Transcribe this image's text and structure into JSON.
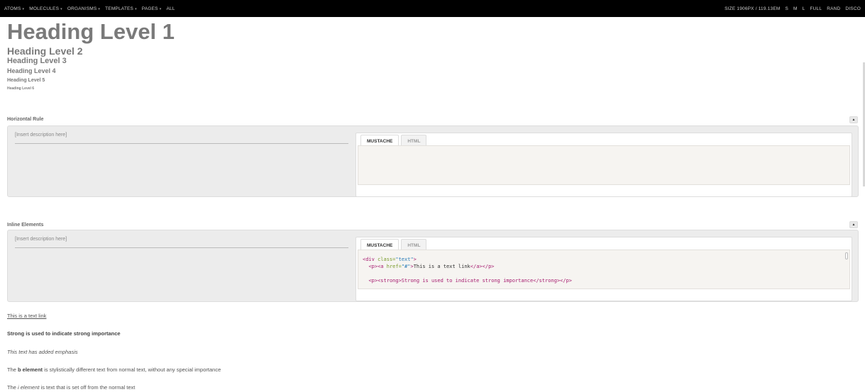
{
  "topnav": {
    "left_items": [
      {
        "label": "ATOMS",
        "caret": "▾"
      },
      {
        "label": "MOLECULES",
        "caret": "▾"
      },
      {
        "label": "ORGANISMS",
        "caret": "▾"
      },
      {
        "label": "TEMPLATES",
        "caret": "▾"
      },
      {
        "label": "PAGES",
        "caret": "▾"
      },
      {
        "label": "ALL",
        "caret": ""
      }
    ],
    "size_label": "SIZE 1906PX / 119.13EM",
    "right_items": [
      "S",
      "M",
      "L",
      "FULL",
      "RAND",
      "DISCO"
    ]
  },
  "headings": {
    "h1": "Heading Level 1",
    "h2": "Heading Level 2",
    "h3": "Heading Level 3",
    "h4": "Heading Level 4",
    "h5": "Heading Level 5",
    "h6": "Heading Level 6"
  },
  "sections": [
    {
      "title": "Horizontal Rule",
      "toggle": "▲",
      "description": "[Insert description here]",
      "tabs": [
        "MUSTACHE",
        "HTML"
      ],
      "code": ""
    },
    {
      "title": "Inline Elements",
      "toggle": "▲",
      "description": "[Insert description here]",
      "tabs": [
        "MUSTACHE",
        "HTML"
      ],
      "code_lines": {
        "l1_tag_open": "<div ",
        "l1_attr": "class=",
        "l1_str": "\"text\"",
        "l1_close": ">",
        "l2_tag_p": "<p>",
        "l2_tag_a": "<a ",
        "l2_attr": "href=",
        "l2_str": "\"#\"",
        "l2_gt": ">",
        "l2_text": "This is a text link",
        "l2_end": "</a></p>",
        "l3": "<p><strong>Strong is used to indicate strong importance</strong></p>"
      }
    }
  ],
  "samples": {
    "link": "This is a text link",
    "strong": "Strong is used to indicate strong importance",
    "em": "This text has added emphasis",
    "b_pre": "The ",
    "b_bold": "b element",
    "b_post": " is stylistically different text from normal text, without any special importance",
    "i_pre": "The ",
    "i_em": "i element",
    "i_post": " is text that is set off from the normal text"
  }
}
